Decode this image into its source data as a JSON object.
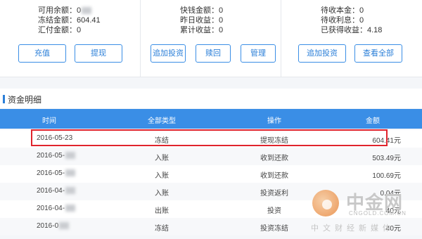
{
  "account_summary": {
    "panel1": {
      "available_label": "可用余额：",
      "available_value": "0",
      "frozen_label": "冻结金额：",
      "frozen_value": "604.41",
      "remit_label": "汇付金额：",
      "remit_value": "0",
      "recharge_button": "充值",
      "withdraw_button": "提现"
    },
    "panel2": {
      "quick_label": "快钱金额：",
      "quick_value": "0",
      "yesterday_label": "昨日收益：",
      "yesterday_value": "0",
      "cumulative_label": "累计收益：",
      "cumulative_value": "0",
      "add_invest_button": "追加投资",
      "redeem_button": "赎回",
      "manage_button": "管理"
    },
    "panel3": {
      "principal_label": "待收本金：",
      "principal_value": "0",
      "interest_label": "待收利息：",
      "interest_value": "0",
      "earned_label": "已获得收益：",
      "earned_value": "4.18",
      "add_invest_button": "追加投资",
      "view_all_button": "查看全部"
    }
  },
  "fund_details": {
    "title": "资金明细",
    "headers": [
      "时间",
      "全部类型",
      "操作",
      "金额"
    ],
    "rows": [
      {
        "date": "2016-05-23",
        "type": "冻结",
        "operation": "提现冻结",
        "amount": "604.41元"
      },
      {
        "date": "2016-05-",
        "type": "入账",
        "operation": "收到还款",
        "amount": "503.49元"
      },
      {
        "date": "2016-05-",
        "type": "入账",
        "operation": "收到还款",
        "amount": "100.69元"
      },
      {
        "date": "2016-04-",
        "type": "入账",
        "operation": "投资返利",
        "amount": "0.04元"
      },
      {
        "date": "2016-04-",
        "type": "出账",
        "operation": "投资",
        "amount": "40元"
      },
      {
        "date": "2016-0",
        "type": "冻结",
        "operation": "投资冻结",
        "amount": "40元"
      }
    ],
    "highlight_color": "#e0242d",
    "header_color": "#3a8ee6"
  },
  "watermark": {
    "name": "中金网",
    "url": "CNGOLD.COM.CN",
    "tagline": "中文财经新媒体"
  }
}
